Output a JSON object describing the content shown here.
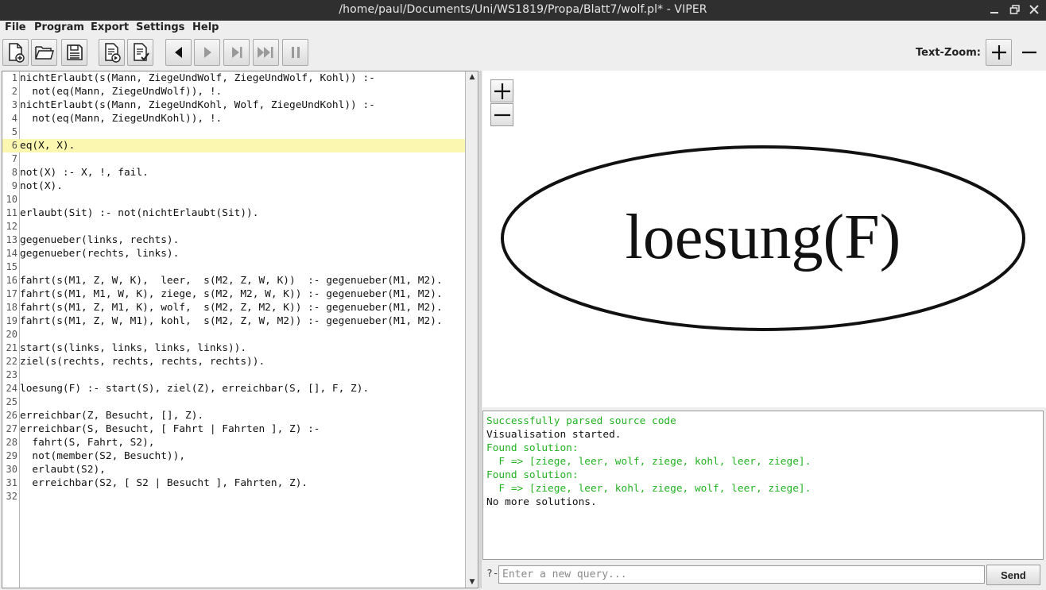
{
  "window": {
    "title": "/home/paul/Documents/Uni/WS1819/Propa/Blatt7/wolf.pl* - VIPER"
  },
  "menu": {
    "items": [
      "File",
      "Program",
      "Export",
      "Settings",
      "Help"
    ]
  },
  "toolbar": {
    "text_zoom_label": "Text-Zoom:",
    "buttons": [
      "new-file",
      "open-file",
      "save-file",
      "export",
      "check",
      "step-back",
      "play",
      "step",
      "run-to-end",
      "pause"
    ]
  },
  "editor": {
    "highlighted_line": 6,
    "lines": [
      {
        "n": "1",
        "text": "nichtErlaubt(s(Mann, ZiegeUndWolf, ZiegeUndWolf, Kohl)) :-"
      },
      {
        "n": "2",
        "text": "  not(eq(Mann, ZiegeUndWolf)), !."
      },
      {
        "n": "3",
        "text": "nichtErlaubt(s(Mann, ZiegeUndKohl, Wolf, ZiegeUndKohl)) :-"
      },
      {
        "n": "4",
        "text": "  not(eq(Mann, ZiegeUndKohl)), !."
      },
      {
        "n": "5",
        "text": ""
      },
      {
        "n": "6",
        "text": "eq(X, X)."
      },
      {
        "n": "7",
        "text": ""
      },
      {
        "n": "8",
        "text": "not(X) :- X, !, fail."
      },
      {
        "n": "9",
        "text": "not(X)."
      },
      {
        "n": "10",
        "text": ""
      },
      {
        "n": "11",
        "text": "erlaubt(Sit) :- not(nichtErlaubt(Sit))."
      },
      {
        "n": "12",
        "text": ""
      },
      {
        "n": "13",
        "text": "gegenueber(links, rechts)."
      },
      {
        "n": "14",
        "text": "gegenueber(rechts, links)."
      },
      {
        "n": "15",
        "text": ""
      },
      {
        "n": "16",
        "text": "fahrt(s(M1, Z, W, K),  leer,  s(M2, Z, W, K))  :- gegenueber(M1, M2)."
      },
      {
        "n": "17",
        "text": "fahrt(s(M1, M1, W, K), ziege, s(M2, M2, W, K)) :- gegenueber(M1, M2)."
      },
      {
        "n": "18",
        "text": "fahrt(s(M1, Z, M1, K), wolf,  s(M2, Z, M2, K)) :- gegenueber(M1, M2)."
      },
      {
        "n": "19",
        "text": "fahrt(s(M1, Z, W, M1), kohl,  s(M2, Z, W, M2)) :- gegenueber(M1, M2)."
      },
      {
        "n": "20",
        "text": ""
      },
      {
        "n": "21",
        "text": "start(s(links, links, links, links))."
      },
      {
        "n": "22",
        "text": "ziel(s(rechts, rechts, rechts, rechts))."
      },
      {
        "n": "23",
        "text": ""
      },
      {
        "n": "24",
        "text": "loesung(F) :- start(S), ziel(Z), erreichbar(S, [], F, Z)."
      },
      {
        "n": "25",
        "text": ""
      },
      {
        "n": "26",
        "text": "erreichbar(Z, Besucht, [], Z)."
      },
      {
        "n": "27",
        "text": "erreichbar(S, Besucht, [ Fahrt | Fahrten ], Z) :-"
      },
      {
        "n": "28",
        "text": "  fahrt(S, Fahrt, S2),"
      },
      {
        "n": "29",
        "text": "  not(member(S2, Besucht)),"
      },
      {
        "n": "30",
        "text": "  erlaubt(S2),"
      },
      {
        "n": "31",
        "text": "  erreichbar(S2, [ S2 | Besucht ], Fahrten, Z)."
      },
      {
        "n": "32",
        "text": ""
      }
    ]
  },
  "graph": {
    "node_label": "loesung(F)"
  },
  "console": {
    "success_color": "#22b222",
    "lines": [
      {
        "text": "Successfully parsed source code",
        "color": "#22b222"
      },
      {
        "text": "Visualisation started.",
        "color": "#111111"
      },
      {
        "text": "Found solution:",
        "color": "#22b222"
      },
      {
        "text": "  F => [ziege, leer, wolf, ziege, kohl, leer, ziege].",
        "color": "#22b222"
      },
      {
        "text": "Found solution:",
        "color": "#22b222"
      },
      {
        "text": "  F => [ziege, leer, kohl, ziege, wolf, leer, ziege].",
        "color": "#22b222"
      },
      {
        "text": "No more solutions.",
        "color": "#111111"
      }
    ]
  },
  "query": {
    "prefix": "?-",
    "placeholder": "Enter a new query...",
    "value": "",
    "send_label": "Send"
  }
}
